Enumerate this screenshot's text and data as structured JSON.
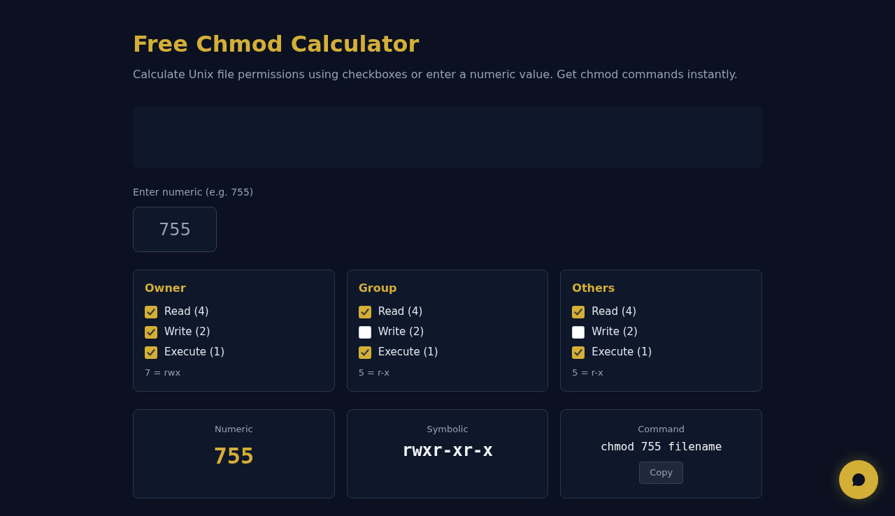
{
  "header": {
    "title": "Free Chmod Calculator",
    "subtitle": "Calculate Unix file permissions using checkboxes or enter a numeric value. Get chmod commands instantly."
  },
  "numeric_input": {
    "label": "Enter numeric (e.g. 755)",
    "value": "755"
  },
  "groups": [
    {
      "title": "Owner",
      "permissions": [
        {
          "label": "Read (4)",
          "checked": true
        },
        {
          "label": "Write (2)",
          "checked": true
        },
        {
          "label": "Execute (1)",
          "checked": true
        }
      ],
      "summary": "7 = rwx"
    },
    {
      "title": "Group",
      "permissions": [
        {
          "label": "Read (4)",
          "checked": true
        },
        {
          "label": "Write (2)",
          "checked": false
        },
        {
          "label": "Execute (1)",
          "checked": true
        }
      ],
      "summary": "5 = r-x"
    },
    {
      "title": "Others",
      "permissions": [
        {
          "label": "Read (4)",
          "checked": true
        },
        {
          "label": "Write (2)",
          "checked": false
        },
        {
          "label": "Execute (1)",
          "checked": true
        }
      ],
      "summary": "5 = r-x"
    }
  ],
  "results": [
    {
      "kind": "numeric",
      "label": "Numeric",
      "value": "755"
    },
    {
      "kind": "symbolic",
      "label": "Symbolic",
      "value": "rwxr-xr-x"
    },
    {
      "kind": "command",
      "label": "Command",
      "value": "chmod 755 filename",
      "button": "Copy"
    }
  ]
}
